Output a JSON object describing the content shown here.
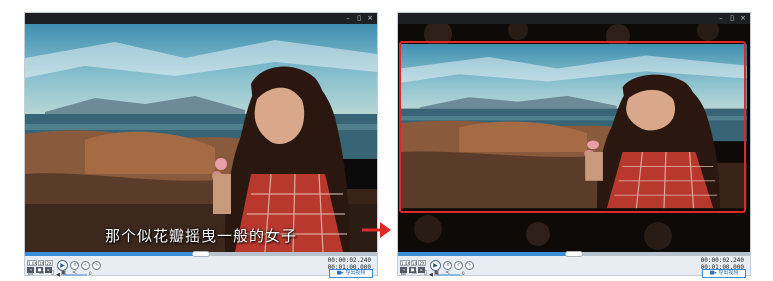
{
  "window": {
    "minimize_icon": "–",
    "restore_icon": "▯",
    "close_icon": "×"
  },
  "left": {
    "subtitle": "那个似花瓣摇曳一般的女子",
    "progress": 0.5,
    "speed_labels": [
      "1.0X",
      "1X",
      "2X"
    ],
    "volume_value": "0",
    "time_current": "00:00:02.240",
    "time_total": "00:01:00.000",
    "export_label": "■▸ 导出视频"
  },
  "right": {
    "progress": 0.5,
    "speed_labels": [
      "1.0X",
      "1X",
      "2X"
    ],
    "volume_value": "0",
    "time_current": "00:00:02.240",
    "time_total": "00:01:00.000",
    "export_label": "■▸ 导出视频"
  },
  "colors": {
    "accent": "#3a8fd8",
    "highlight": "#e02828",
    "arrow": "#e02828"
  }
}
